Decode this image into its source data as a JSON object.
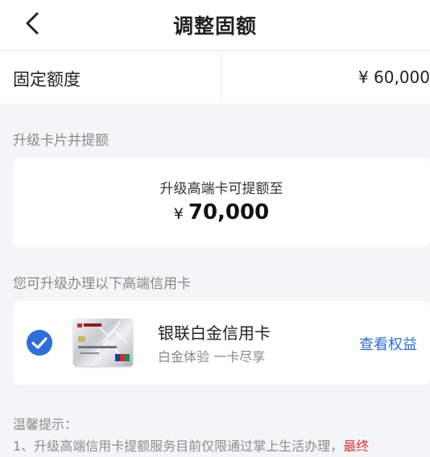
{
  "header": {
    "title": "调整固额",
    "back_icon": "chevron-left-icon"
  },
  "fixed_limit": {
    "label": "固定额度",
    "value": "¥ 60,000"
  },
  "upgrade_section": {
    "title": "升级卡片并提额",
    "caption": "升级高端卡可提额至",
    "currency": "¥",
    "amount": "70,000"
  },
  "cards_section": {
    "title": "您可升级办理以下高端信用卡",
    "card": {
      "name": "银联白金信用卡",
      "tagline": "白金体验 一卡尽享",
      "benefits_link": "查看权益",
      "selected": true,
      "check_icon": "check-circle-icon",
      "image_icon": "credit-card-image"
    }
  },
  "tips": {
    "title": "温馨提示：",
    "line1": "1、升级高端信用卡提额服务目前仅限通过掌上生活办理，",
    "line1_highlight": "最终"
  },
  "colors": {
    "accent": "#2d6fd6",
    "highlight": "#e0343a",
    "background": "#f4f5f7"
  }
}
